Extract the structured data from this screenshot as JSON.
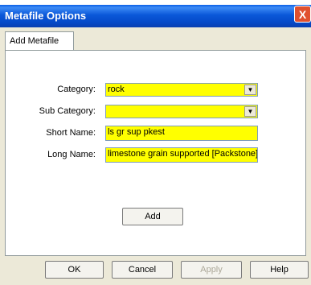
{
  "window": {
    "title": "Metafile Options",
    "close_label": "X"
  },
  "tab": {
    "label": "Add Metafile"
  },
  "form": {
    "category_label": "Category:",
    "category_value": "rock",
    "sub_category_label": "Sub Category:",
    "sub_category_value": "",
    "short_name_label": "Short Name:",
    "short_name_value": "ls gr sup pkest",
    "long_name_label": "Long Name:",
    "long_name_value": "limestone grain supported [Packstone]"
  },
  "buttons": {
    "add": "Add",
    "ok": "OK",
    "cancel": "Cancel",
    "apply": "Apply",
    "help": "Help"
  },
  "colors": {
    "field_highlight": "#ffff00",
    "title_bar": "#0548c6",
    "close_button": "#e0502e"
  }
}
